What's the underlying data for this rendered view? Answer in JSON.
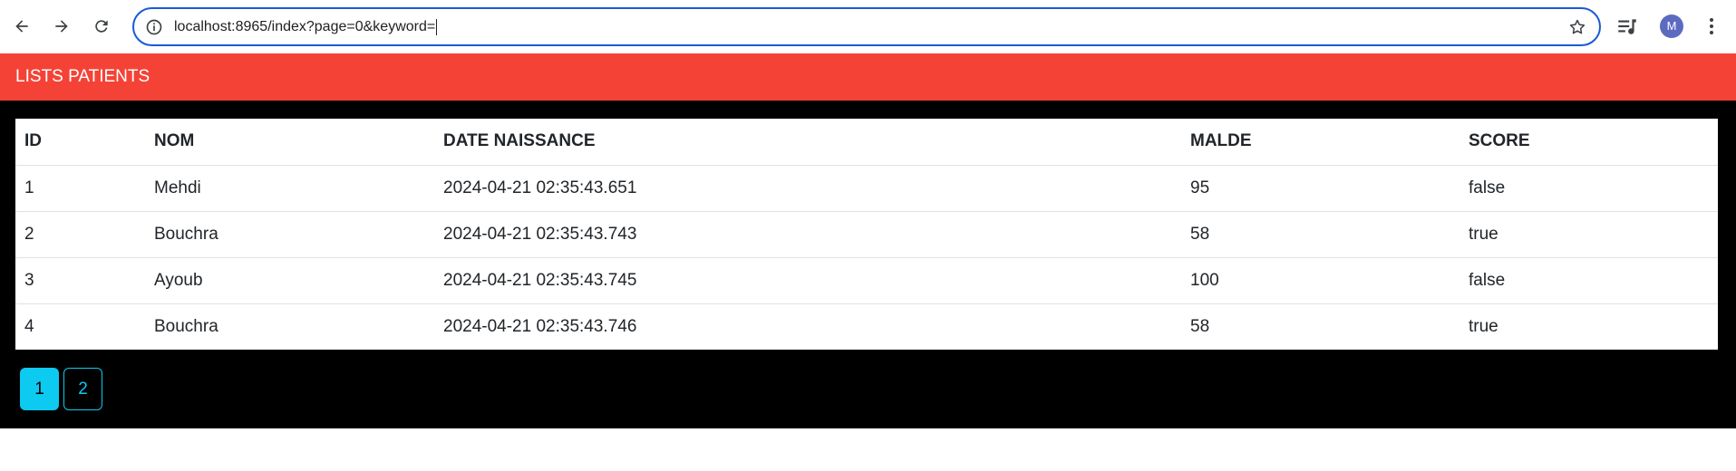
{
  "browser": {
    "url": "localhost:8965/index?page=0&keyword=",
    "avatar_initial": "M"
  },
  "colors": {
    "header_bg": "#f44336",
    "page_bg": "#000000",
    "pagination_accent": "#0dcaf0",
    "omnibox_border": "#1a5ad7"
  },
  "card": {
    "title": "LISTS PATIENTS"
  },
  "table": {
    "headers": {
      "id": "ID",
      "nom": "NOM",
      "date": "DATE NAISSANCE",
      "malde": "MALDE",
      "score": "SCORE"
    },
    "rows": [
      {
        "id": "1",
        "nom": "Mehdi",
        "date": "2024-04-21 02:35:43.651",
        "malde": "95",
        "score": "false"
      },
      {
        "id": "2",
        "nom": "Bouchra",
        "date": "2024-04-21 02:35:43.743",
        "malde": "58",
        "score": "true"
      },
      {
        "id": "3",
        "nom": "Ayoub",
        "date": "2024-04-21 02:35:43.745",
        "malde": "100",
        "score": "false"
      },
      {
        "id": "4",
        "nom": "Bouchra",
        "date": "2024-04-21 02:35:43.746",
        "malde": "58",
        "score": "true"
      }
    ]
  },
  "pagination": {
    "pages": [
      "1",
      "2"
    ],
    "active_index": 0
  }
}
